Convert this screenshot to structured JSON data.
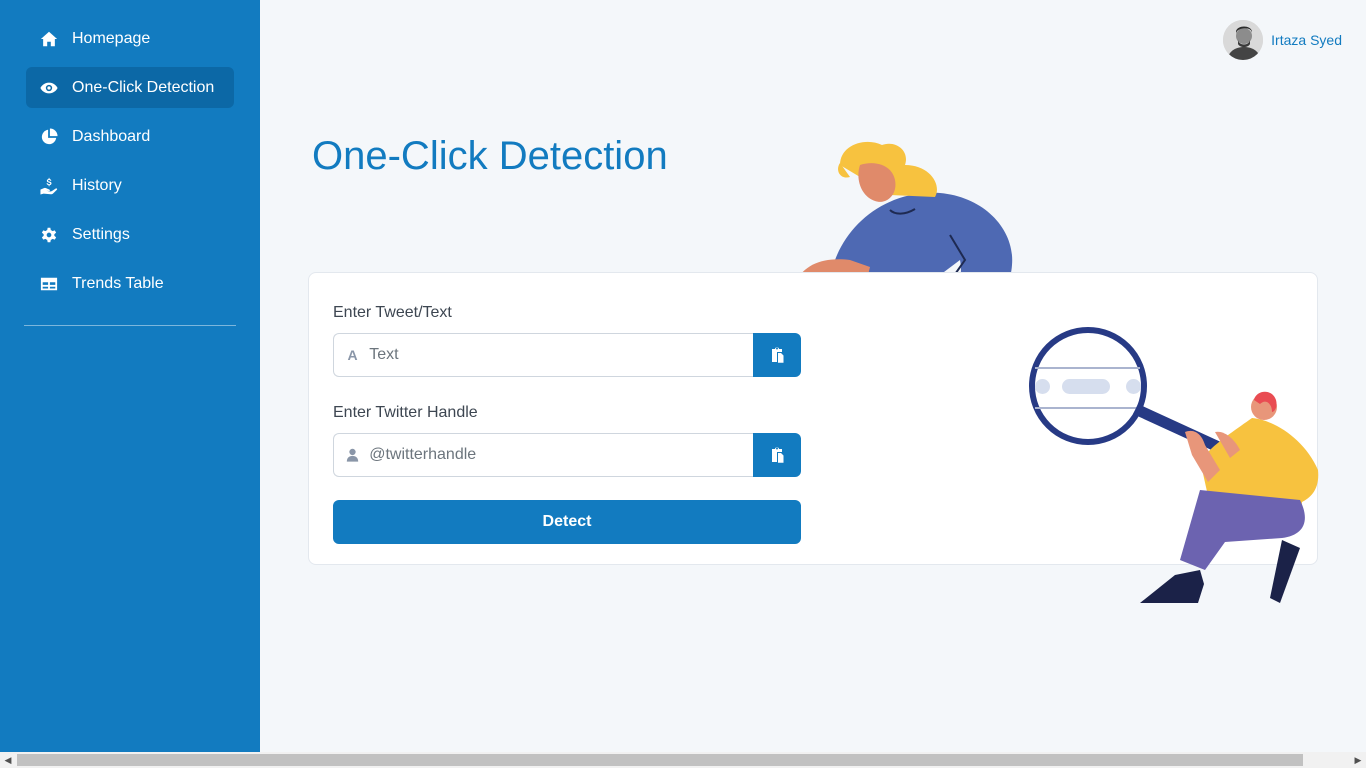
{
  "sidebar": {
    "items": [
      {
        "label": "Homepage",
        "icon": "home-icon"
      },
      {
        "label": "One-Click Detection",
        "icon": "eye-icon",
        "active": true
      },
      {
        "label": "Dashboard",
        "icon": "pie-chart-icon"
      },
      {
        "label": "History",
        "icon": "hand-dollar-icon"
      },
      {
        "label": "Settings",
        "icon": "gear-icon"
      },
      {
        "label": "Trends Table",
        "icon": "table-icon"
      }
    ]
  },
  "user": {
    "name": "Irtaza Syed",
    "avatar": "user-avatar"
  },
  "page": {
    "title": "One-Click Detection"
  },
  "form": {
    "tweet_label": "Enter Tweet/Text",
    "tweet_placeholder": "Text",
    "handle_label": "Enter Twitter Handle",
    "handle_placeholder": "@twitterhandle",
    "detect_label": "Detect"
  },
  "colors": {
    "primary": "#127bc0",
    "sidebar_active": "#0c68a6",
    "background": "#f4f7fa"
  }
}
